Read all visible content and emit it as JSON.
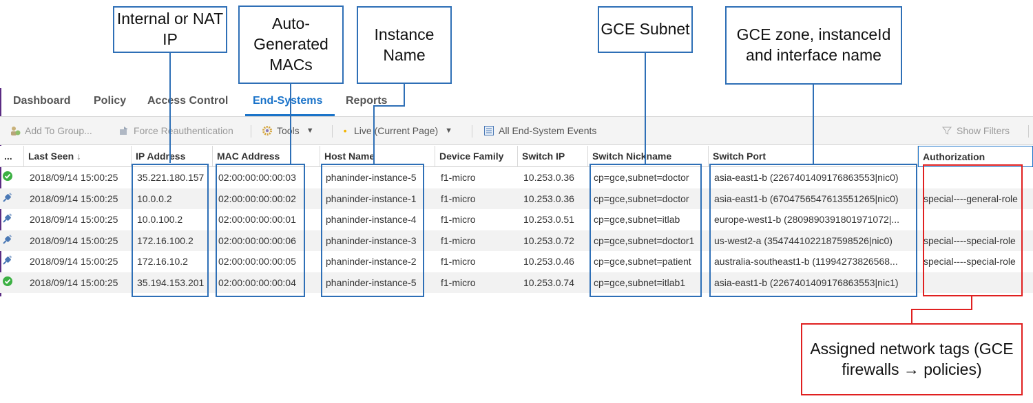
{
  "nav": {
    "tabs": [
      {
        "label": "Dashboard"
      },
      {
        "label": "Policy"
      },
      {
        "label": "Access Control"
      },
      {
        "label": "End-Systems"
      },
      {
        "label": "Reports"
      }
    ],
    "active_tab": "End-Systems"
  },
  "toolbar": {
    "add_to_group": "Add To Group...",
    "force_reauth": "Force Reauthentication",
    "tools": "Tools",
    "live": "Live (Current Page)",
    "events": "All End-System Events",
    "show_filters": "Show Filters"
  },
  "table": {
    "columns": {
      "more": "...",
      "last_seen": "Last Seen",
      "ip": "IP Address",
      "mac": "MAC Address",
      "host": "Host Name",
      "device": "Device Family",
      "switch_ip": "Switch IP",
      "nickname": "Switch Nickname",
      "port": "Switch Port",
      "auth": "Authorization"
    },
    "sort_indicator": "↓",
    "rows": [
      {
        "status": "check",
        "last_seen": "2018/09/14 15:00:25",
        "ip": "35.221.180.157",
        "mac": "02:00:00:00:00:03",
        "host": "phaninder-instance-5",
        "device": "f1-micro",
        "switch_ip": "10.253.0.36",
        "nickname": "cp=gce,subnet=doctor",
        "port": "asia-east1-b (2267401409176863553|nic0)",
        "auth": ""
      },
      {
        "status": "plug",
        "last_seen": "2018/09/14 15:00:25",
        "ip": "10.0.0.2",
        "mac": "02:00:00:00:00:02",
        "host": "phaninder-instance-1",
        "device": "f1-micro",
        "switch_ip": "10.253.0.36",
        "nickname": "cp=gce,subnet=doctor",
        "port": "asia-east1-b (6704756547613551265|nic0)",
        "auth": "special----general-role"
      },
      {
        "status": "plug",
        "last_seen": "2018/09/14 15:00:25",
        "ip": "10.0.100.2",
        "mac": "02:00:00:00:00:01",
        "host": "phaninder-instance-4",
        "device": "f1-micro",
        "switch_ip": "10.253.0.51",
        "nickname": "cp=gce,subnet=itlab",
        "port": "europe-west1-b (2809890391801971072|...",
        "auth": ""
      },
      {
        "status": "plug",
        "last_seen": "2018/09/14 15:00:25",
        "ip": "172.16.100.2",
        "mac": "02:00:00:00:00:06",
        "host": "phaninder-instance-3",
        "device": "f1-micro",
        "switch_ip": "10.253.0.72",
        "nickname": "cp=gce,subnet=doctor1",
        "port": "us-west2-a (3547441022187598526|nic0)",
        "auth": "special----special-role"
      },
      {
        "status": "plug",
        "last_seen": "2018/09/14 15:00:25",
        "ip": "172.16.10.2",
        "mac": "02:00:00:00:00:05",
        "host": "phaninder-instance-2",
        "device": "f1-micro",
        "switch_ip": "10.253.0.46",
        "nickname": "cp=gce,subnet=patient",
        "port": "australia-southeast1-b (11994273826568...",
        "auth": "special----special-role"
      },
      {
        "status": "check",
        "last_seen": "2018/09/14 15:00:25",
        "ip": "35.194.153.201",
        "mac": "02:00:00:00:00:04",
        "host": "phaninder-instance-5",
        "device": "f1-micro",
        "switch_ip": "10.253.0.74",
        "nickname": "cp=gce,subnet=itlab1",
        "port": "asia-east1-b (2267401409176863553|nic1)",
        "auth": ""
      }
    ]
  },
  "annotations": {
    "nat_ip": "Internal or NAT IP",
    "macs": "Auto-Generated MACs",
    "instance": "Instance Name",
    "subnet": "GCE Subnet",
    "zone": "GCE zone, instanceId and interface name",
    "tags": "Assigned network tags (GCE firewalls → policies)"
  },
  "colors": {
    "accent": "#1a73c9",
    "callout_border": "#2e6fb6",
    "tag_border": "#e02020",
    "status_ok": "#3cb043",
    "status_plug": "#4a78b5"
  }
}
